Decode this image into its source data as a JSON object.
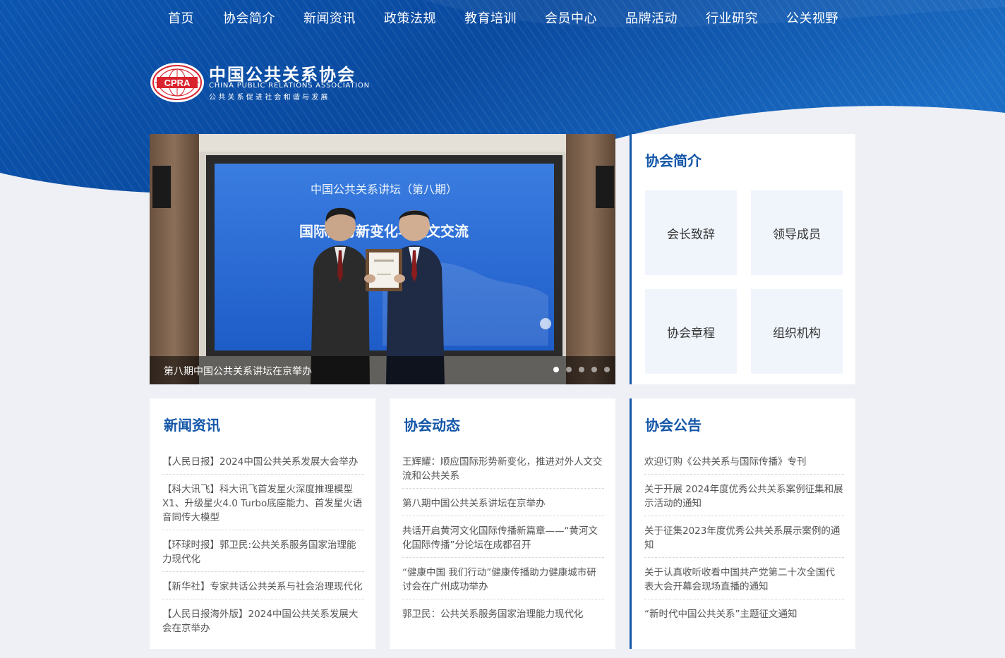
{
  "nav": {
    "items": [
      {
        "label": "首页"
      },
      {
        "label": "协会简介"
      },
      {
        "label": "新闻资讯"
      },
      {
        "label": "政策法规"
      },
      {
        "label": "教育培训"
      },
      {
        "label": "会员中心"
      },
      {
        "label": "品牌活动"
      },
      {
        "label": "行业研究"
      },
      {
        "label": "公关视野"
      }
    ]
  },
  "logo": {
    "emblem_text": "CPRA",
    "name_cn": "中国公共关系协会",
    "name_en": "CHINA PUBLIC RELATIONS ASSOCIATION",
    "slogan": "公共关系促进社会和谐与发展"
  },
  "carousel": {
    "screen_title": "中国公共关系讲坛（第八期）",
    "screen_subtitle": "国际形势新变化与人文交流",
    "caption": "第八期中国公共关系讲坛在京举办",
    "slide_count": 5,
    "active_index": 0
  },
  "about": {
    "title": "协会简介",
    "tiles": [
      {
        "label": "会长致辞"
      },
      {
        "label": "领导成员"
      },
      {
        "label": "协会章程"
      },
      {
        "label": "组织机构"
      }
    ]
  },
  "news": {
    "title": "新闻资讯",
    "items": [
      "【人民日报】2024中国公共关系发展大会举办",
      "【科大讯飞】科大讯飞首发星火深度推理模型X1、升级星火4.0 Turbo底座能力、首发星火语音同传大模型",
      "【环球时报】郭卫民:公共关系服务国家治理能力现代化",
      "【新华社】专家共话公共关系与社会治理现代化",
      "【人民日报海外版】2024中国公共关系发展大会在京举办"
    ]
  },
  "dynamics": {
    "title": "协会动态",
    "items": [
      "王辉耀：顺应国际形势新变化，推进对外人文交流和公共关系",
      "第八期中国公共关系讲坛在京举办",
      "共话开启黄河文化国际传播新篇章——“黄河文化国际传播”分论坛在成都召开",
      "“健康中国 我们行动”健康传播助力健康城市研讨会在广州成功举办",
      "郭卫民：公共关系服务国家治理能力现代化"
    ]
  },
  "notices": {
    "title": "协会公告",
    "items": [
      "欢迎订购《公共关系与国际传播》专刊",
      "关于开展 2024年度优秀公共关系案例征集和展示活动的通知",
      "关于征集2023年度优秀公共关系展示案例的通知",
      "关于认真收听收看中国共产党第二十次全国代表大会开幕会现场直播的通知",
      "“新时代中国公共关系”主题征文通知"
    ]
  },
  "colors": {
    "brand_blue": "#1356a8",
    "header_blue": "#0a4fa6",
    "tile_bg": "#f0f5fc"
  }
}
